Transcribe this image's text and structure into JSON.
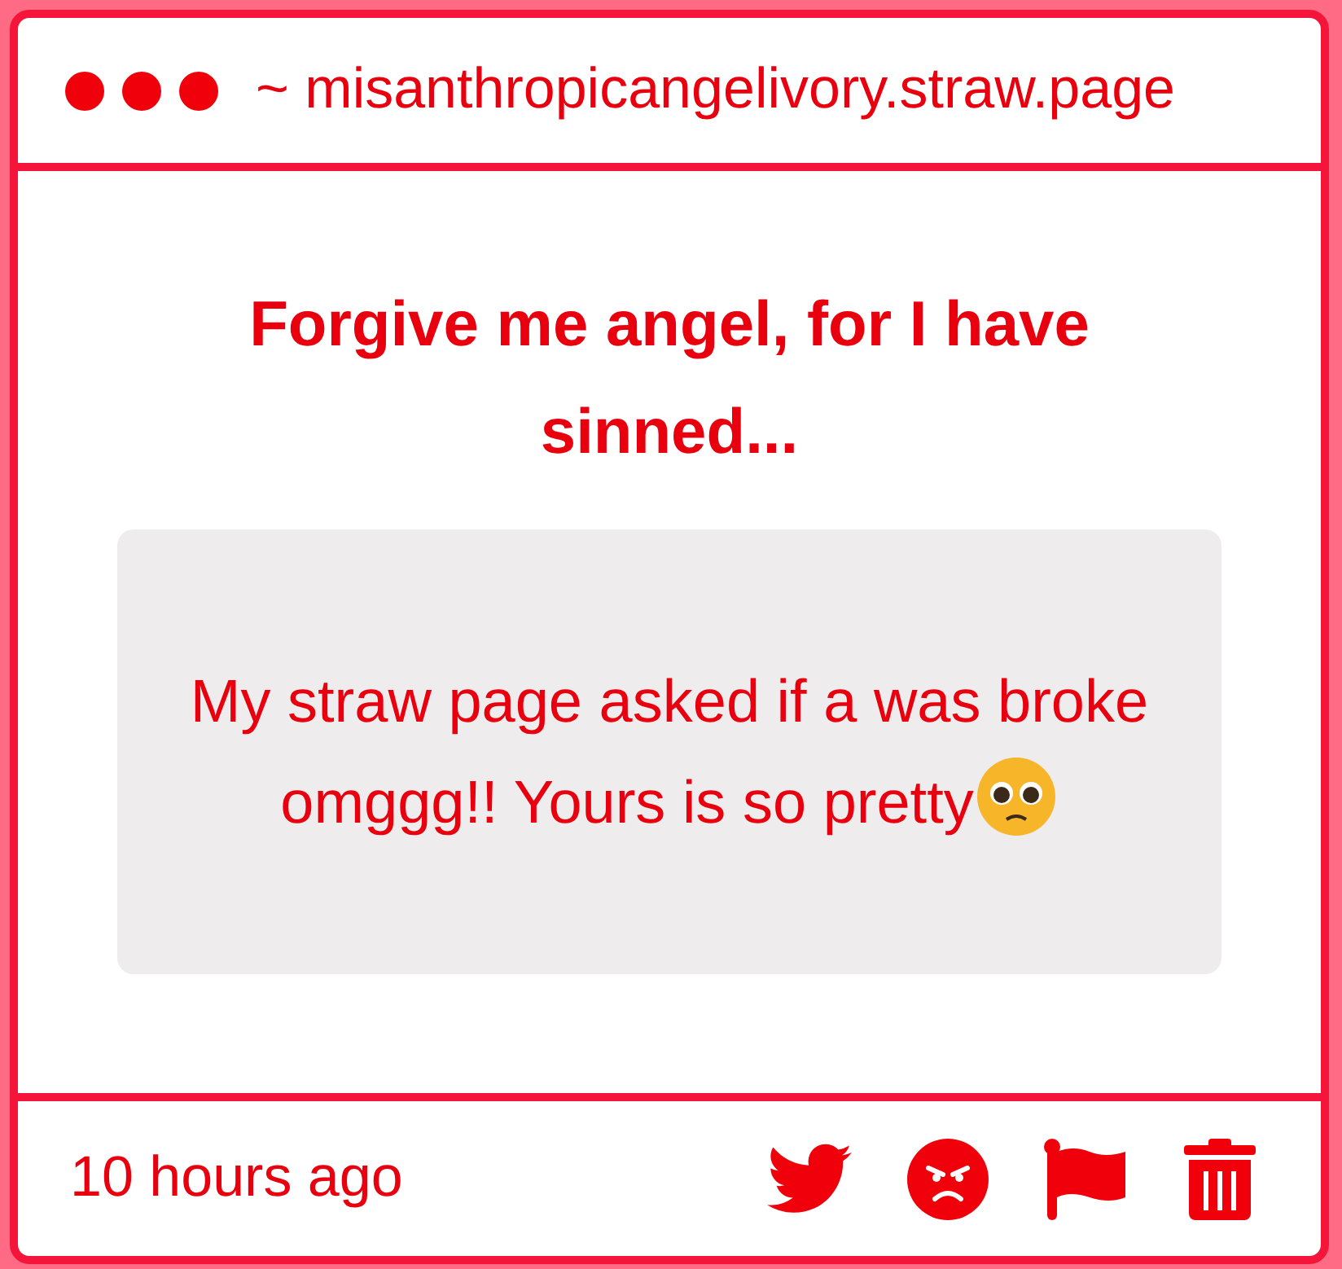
{
  "window": {
    "title": "~ misanthropicangelivory.straw.page"
  },
  "question": {
    "title": "Forgive me angel, for I have sinned...",
    "message": "My straw page asked if a was broke omggg!! Yours is so pretty"
  },
  "footer": {
    "time": "10 hours ago",
    "actions": [
      {
        "kind": "twitter"
      },
      {
        "kind": "angry"
      },
      {
        "kind": "flag"
      },
      {
        "kind": "delete"
      }
    ]
  }
}
